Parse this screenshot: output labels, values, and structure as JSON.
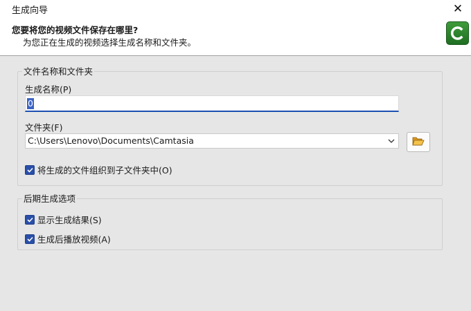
{
  "window": {
    "title": "生成向导"
  },
  "header": {
    "title": "您要将您的视频文件保存在哪里?",
    "subtitle": "为您正在生成的视频选择生成名称和文件夹。",
    "logo_icon": "camtasia-logo-icon"
  },
  "file_group": {
    "title": "文件名称和文件夹",
    "name_label": "生成名称(P)",
    "name_value": "0",
    "folder_label": "文件夹(F)",
    "folder_value": "C:\\Users\\Lenovo\\Documents\\Camtasia",
    "organize_label": "将生成的文件组织到子文件夹中(O)",
    "organize_checked": true
  },
  "post_group": {
    "title": "后期生成选项",
    "show_results_label": "显示生成结果(S)",
    "show_results_checked": true,
    "play_video_label": "生成后播放视频(A)",
    "play_video_checked": true
  },
  "colors": {
    "accent": "#2a4fa8",
    "logo": "#2e8b32"
  }
}
